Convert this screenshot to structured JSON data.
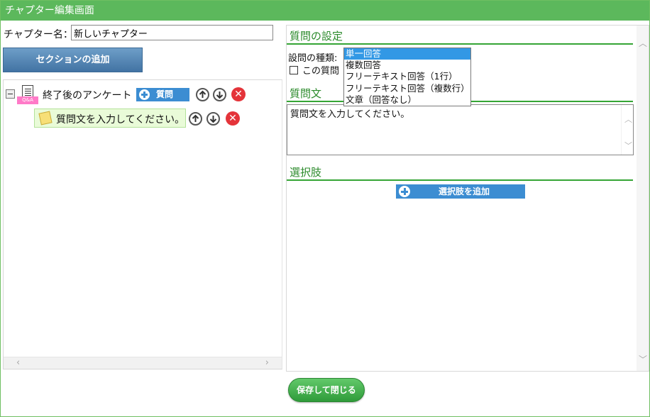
{
  "window": {
    "title": "チャプター編集画面"
  },
  "chapter": {
    "name_label": "チャプター名：",
    "name_value": "新しいチャプター"
  },
  "toolbar": {
    "add_section_label": "セクションの追加"
  },
  "tree": {
    "section": {
      "label": "終了後のアンケート",
      "icon_tag": "Q&A",
      "add_question_label": "質問"
    },
    "questions": [
      {
        "label": "質問文を入力してください。"
      }
    ]
  },
  "settings": {
    "heading": "質問の設定",
    "type_label": "設問の種類:",
    "type_options": [
      "単一回答",
      "複数回答",
      "フリーテキスト回答（1行）",
      "フリーテキスト回答（複数行）",
      "文章（回答なし）"
    ],
    "selected_type": "単一回答",
    "checkbox_label": "この質問",
    "question_heading": "質問文",
    "question_text": "質問文を入力してください。",
    "choices_heading": "選択肢",
    "add_choice_label": "選択肢を追加"
  },
  "footer": {
    "save_label": "保存して閉じる"
  },
  "colors": {
    "titlebar": "#5cb85c",
    "heading": "#2b8a2b",
    "primary_button": "#3c8dd2",
    "delete": "#e4343a",
    "question_item_bg": "#e9fbd8"
  }
}
